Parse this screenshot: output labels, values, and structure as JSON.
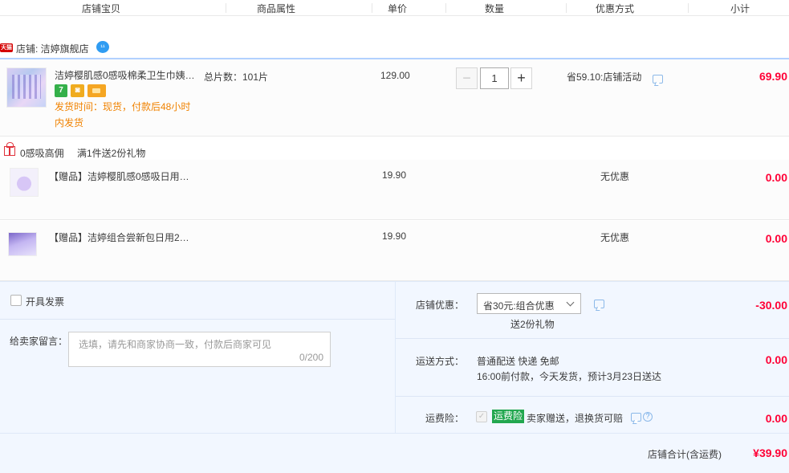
{
  "header": {
    "col_item": "店铺宝贝",
    "col_attr": "商品属性",
    "col_price": "单价",
    "col_qty": "数量",
    "col_discount": "优惠方式",
    "col_subtotal": "小计"
  },
  "shop": {
    "badge": "天猫",
    "label": "店铺: 洁婷旗舰店"
  },
  "item": {
    "title": "洁婷樱肌感0感吸棉柔卫生巾姨…",
    "badge_7": "7",
    "ship_time": "发货时间：现货，付款后48小时内发货",
    "attribute": "总片数：101片",
    "unit_price": "129.00",
    "quantity": "1",
    "qty_minus": "−",
    "qty_plus": "+",
    "discount": "省59.10:店铺活动",
    "subtotal": "69.90"
  },
  "gift_promo": {
    "name": "0感吸高佣",
    "rule": "满1件送2份礼物"
  },
  "gifts": [
    {
      "title": "【赠品】洁婷樱肌感0感吸日用…",
      "price": "19.90",
      "discount": "无优惠",
      "subtotal": "0.00"
    },
    {
      "title": "【赠品】洁婷组合尝新包日用2…",
      "price": "19.90",
      "discount": "无优惠",
      "subtotal": "0.00"
    }
  ],
  "invoice": {
    "label": "开具发票"
  },
  "memo": {
    "label": "给卖家留言：",
    "placeholder": "选填，请先和商家协商一致，付款后商家可见",
    "counter": "0/200"
  },
  "shop_discount": {
    "label": "店铺优惠：",
    "selected": "省30元:组合优惠",
    "note": "送2份礼物",
    "amount": "-30.00"
  },
  "shipping": {
    "label": "运送方式：",
    "method": "普通配送 快递 免邮",
    "eta": "16:00前付款，今天发货，预计3月23日送达",
    "amount": "0.00"
  },
  "insurance": {
    "label": "运费险：",
    "tag": "运费险",
    "desc": "卖家赠送，退换货可赔",
    "amount": "0.00"
  },
  "total": {
    "label": "店铺合计(含运费)",
    "amount": "¥39.90"
  },
  "colors": {
    "price_red": "#ff0036",
    "ship_orange": "#f08200",
    "insurance_green": "#22a74f",
    "bottom_bg": "#f2f7ff"
  }
}
